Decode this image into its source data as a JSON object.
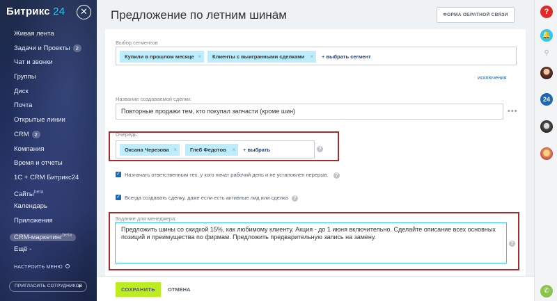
{
  "sidebar": {
    "logo_text": "Битрикс",
    "logo_num": "24",
    "close_glyph": "✕",
    "items": [
      {
        "label": "Живая лента"
      },
      {
        "label": "Задачи и Проекты",
        "badge": "2"
      },
      {
        "label": "Чат и звонки"
      },
      {
        "label": "Группы"
      },
      {
        "label": "Диск"
      },
      {
        "label": "Почта"
      },
      {
        "label": "Открытые линии"
      },
      {
        "label": "CRM",
        "badge": "2"
      },
      {
        "label": "Компания"
      },
      {
        "label": "Время и отчеты"
      },
      {
        "label": "1С + CRM Битрикс24"
      },
      {
        "label": "Сайты",
        "sup": "beta"
      },
      {
        "label": "Календарь"
      },
      {
        "label": "Приложения"
      },
      {
        "label": "CRM-маркетинг",
        "sup": "beta"
      },
      {
        "label": "Ещё -"
      }
    ],
    "settings_label": "НАСТРОИТЬ МЕНЮ",
    "invite_label": "ПРИГЛАСИТЬ СОТРУДНИКОВ",
    "invite_plus": "+"
  },
  "header": {
    "title": "Предложение по летним шинам",
    "edit_icon": "✎",
    "feedback_label": "ФОРМА ОБРАТНОЙ СВЯЗИ"
  },
  "form": {
    "segments_label": "Выбор сегментов",
    "segments": [
      "Купили в прошлом месяце",
      "Клиенты с выигранными сделками"
    ],
    "add_segment": "выбрать сегмент",
    "plus": "+",
    "remove_glyph": "×",
    "exclusions_link": "исключения",
    "deal_name_label": "Название создаваемой сделки:",
    "deal_name_value": "Повторные продажи тем, кто покупал запчасти (кроме шин)",
    "more_glyph": "•••",
    "queue_label": "Очередь:",
    "queue": [
      "Оксана Черезова",
      "Глеб Федотов"
    ],
    "add_queue": "выбрать",
    "help_glyph": "?",
    "check_mark": "✓",
    "checkbox1_text": "Назначать ответственным тех, у кого начат рабочий день и не установлен перерыв.",
    "checkbox2_text": "Всегда создавать сделку, даже если есть активные лид или сделка",
    "task_label": "Задание для менеджера:",
    "task_value": "Предложить шины со скидкой 15%, как любимому клиенту. Акция - до 1 июня включительно. Сделайте описание всех основных позиций и преимущества по фирмам. Предложить предварительную запись на замену."
  },
  "footer": {
    "save_label": "СОХРАНИТЬ",
    "cancel_label": "ОТМЕНА"
  },
  "rail": {
    "help_glyph": "?",
    "bell_glyph": "🔔",
    "search_glyph": "⚲",
    "b24_label": "24",
    "phone_glyph": "✆"
  },
  "colors": {
    "accent": "#2fc6f6",
    "save_green": "#bbed21",
    "highlight_red": "#a52a2a",
    "tag_blue": "#bcedfc"
  }
}
